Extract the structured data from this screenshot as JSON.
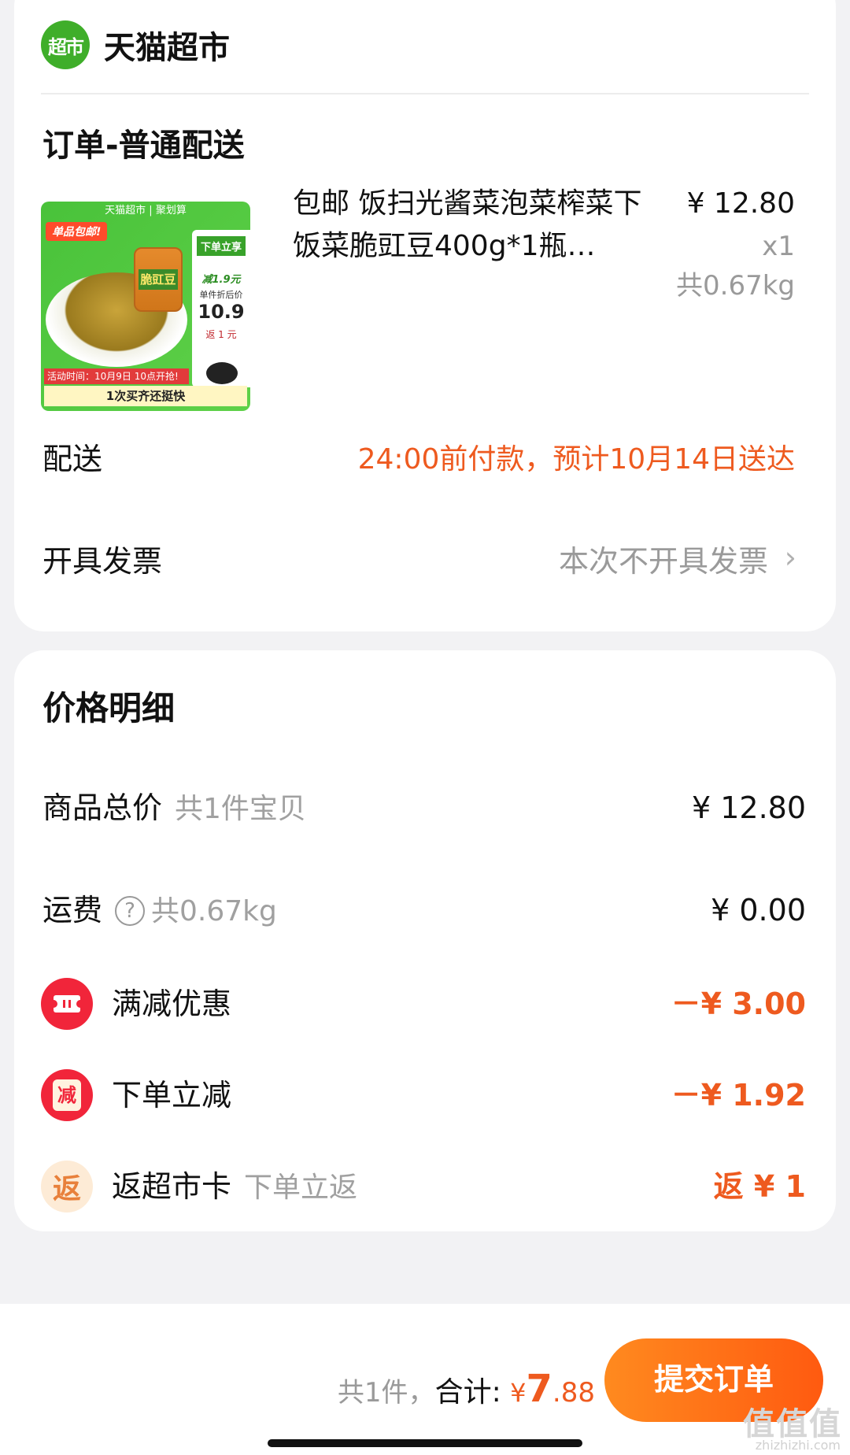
{
  "store": {
    "logo_text": "超市",
    "name": "天猫超市"
  },
  "order": {
    "type": "订单-普通配送",
    "product": {
      "title": "包邮 饭扫光酱菜泡菜榨菜下饭菜脆豇豆400g*1瓶…",
      "price": "¥ 12.80",
      "qty": "x1",
      "weight": "共0.67kg",
      "thumbnail": {
        "top_text": "天猫超市 | 聚划算",
        "badge": "单品包邮!",
        "jar_label": "脆豇豆",
        "side_promo": "下单立享",
        "side_discount": "减1.9元",
        "side_note": "单件折后价",
        "price": "10.9",
        "side_return": "返 1 元",
        "activity": "活动时间：10月9日 10点开抢!",
        "footer": "1次买齐还挺快"
      }
    },
    "delivery": {
      "label": "配送",
      "value": "24:00前付款，预计10月14日送达"
    },
    "invoice": {
      "label": "开具发票",
      "value": "本次不开具发票"
    }
  },
  "price_detail": {
    "title": "价格明细",
    "goods_total": {
      "label": "商品总价",
      "sub": "共1件宝贝",
      "value": "¥ 12.80"
    },
    "shipping": {
      "label": "运费",
      "sub": "共0.67kg",
      "value": "¥ 0.00",
      "help_icon": "?"
    },
    "full_discount": {
      "label": "满减优惠",
      "value": "－¥ 3.00",
      "icon": "ticket-icon"
    },
    "instant_discount": {
      "label": "下单立减",
      "value": "－¥ 1.92",
      "icon_text": "减"
    },
    "card_return": {
      "label": "返超市卡",
      "sub": "下单立返",
      "value": "返 ¥ 1",
      "icon_text": "返"
    }
  },
  "bottom_bar": {
    "count_text": "共1件，",
    "total_label": "合计:",
    "currency": "¥",
    "total_int": "7",
    "total_dec": ".88",
    "submit_label": "提交订单",
    "watermark": "值值值",
    "watermark_sub": "zhizhizhi.com"
  },
  "colors": {
    "accent": "#ee5a1f",
    "brand_green": "#3fae2a",
    "discount_red": "#f1253a"
  }
}
